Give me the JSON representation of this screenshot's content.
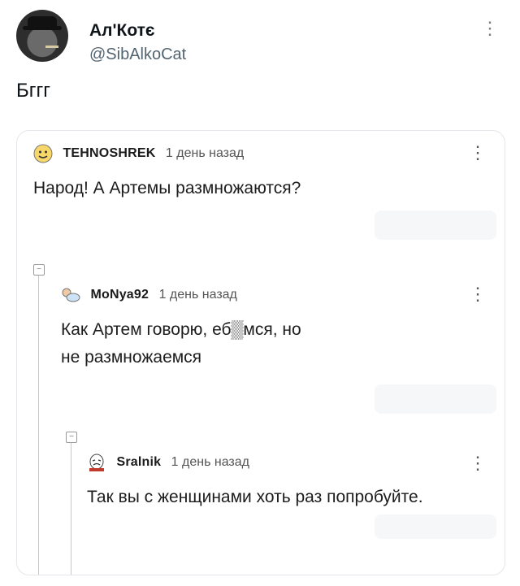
{
  "tweet": {
    "display_name": "Ал'Котє",
    "handle": "@SibAlkoCat",
    "text": "Бггг",
    "more_icon": "more-vertical-icon"
  },
  "quote": {
    "comments": [
      {
        "user": "TEHNOSHREK",
        "time": "1 день назад",
        "text": "Народ! А Артемы размножаются?",
        "icon": "smiley-emoji-icon"
      },
      {
        "user": "MoNya92",
        "time": "1 день назад",
        "text_line1": "Как Артем говорю, еб▒мся, но",
        "text_line2": "не размножаемся",
        "icon": "crawling-baby-icon"
      },
      {
        "user": "Sralnik",
        "time": "1 день назад",
        "text": "Так вы с женщинами хоть раз попробуйте.",
        "icon": "meme-face-icon"
      }
    ],
    "collapse_symbol": "−"
  }
}
